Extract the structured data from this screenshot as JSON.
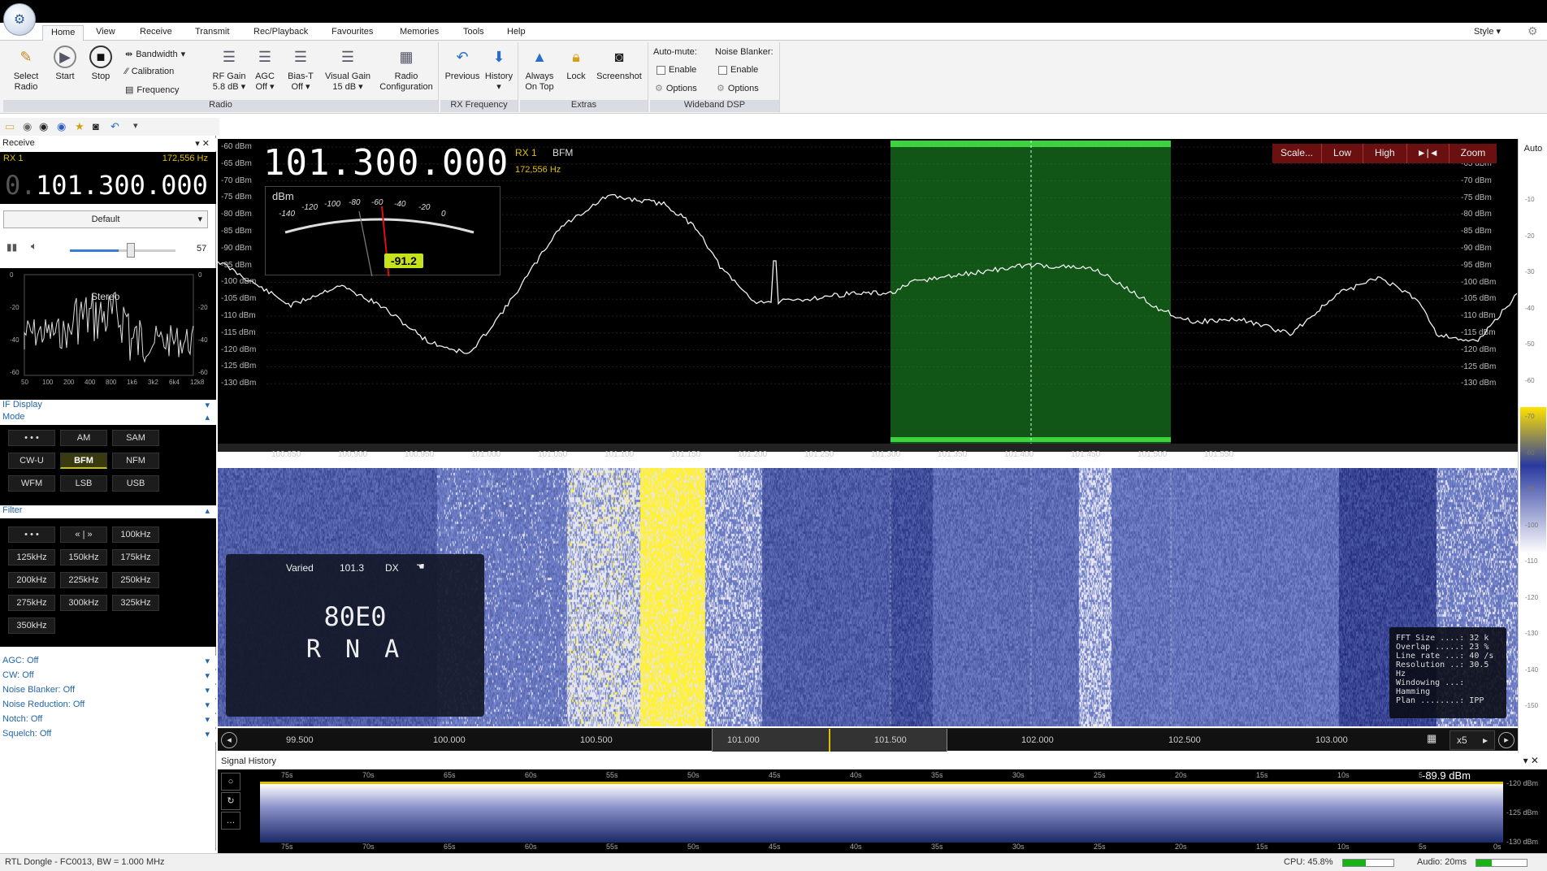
{
  "tabs": [
    "Home",
    "View",
    "Receive",
    "Transmit",
    "Rec/Playback",
    "Favourites",
    "Memories",
    "Tools",
    "Help"
  ],
  "style_label": "Style",
  "ribbon": {
    "radio": {
      "group": "Radio",
      "select_radio": "Select Radio",
      "start": "Start",
      "stop": "Stop",
      "bandwidth": "Bandwidth",
      "calibration": "Calibration",
      "frequency": "Frequency",
      "rf_gain": "RF Gain",
      "rf_gain_val": "5.8 dB",
      "agc": "AGC",
      "agc_val": "Off",
      "bias_t": "Bias-T",
      "bias_t_val": "Off",
      "visual_gain": "Visual Gain",
      "visual_gain_val": "15 dB",
      "radio_config": "Radio Configuration"
    },
    "rx_frequency": {
      "group": "RX Frequency",
      "previous": "Previous",
      "history": "History"
    },
    "extras": {
      "group": "Extras",
      "always_on_top": "Always On Top",
      "lock": "Lock",
      "screenshot": "Screenshot"
    },
    "wideband_dsp": {
      "group": "Wideband DSP",
      "auto_mute": "Auto-mute:",
      "noise_blanker": "Noise Blanker:",
      "enable": "Enable",
      "options": "Options"
    }
  },
  "receive_panel": {
    "header": "Receive",
    "rx": "RX 1",
    "rx_freq": "172,556 Hz",
    "freq_prefix": "0.",
    "frequency": "101.300.000",
    "profile": "Default",
    "volume": "57",
    "scope_label": "Stereo",
    "scope_x": [
      "50",
      "100",
      "200",
      "400",
      "800",
      "1k6",
      "3k2",
      "6k4",
      "12k8"
    ],
    "scope_y": [
      "0",
      "-20",
      "-40",
      "-60"
    ],
    "if_display": "IF Display",
    "mode": "Mode",
    "modes": [
      "• • •",
      "AM",
      "SAM",
      "CW-U",
      "BFM",
      "NFM",
      "WFM",
      "LSB",
      "USB"
    ],
    "filter": "Filter",
    "filters": [
      "• • •",
      "« | »",
      "100kHz",
      "125kHz",
      "150kHz",
      "175kHz",
      "200kHz",
      "225kHz",
      "250kHz",
      "275kHz",
      "300kHz",
      "325kHz",
      "350kHz"
    ],
    "options": [
      "AGC: Off",
      "CW: Off",
      "Noise Blanker: Off",
      "Noise Reduction: Off",
      "Notch: Off",
      "Squelch: Off"
    ]
  },
  "spectrum": {
    "frequency": "101.300.000",
    "rx": "RX 1",
    "mode": "BFM",
    "offset": "172,556 Hz",
    "meter_unit": "dBm",
    "meter_ticks": [
      "-140",
      "-120",
      "-100",
      "-80",
      "-60",
      "-40",
      "-20",
      "0"
    ],
    "meter_value": "-91.2",
    "buttons": [
      "Scale...",
      "Low",
      "High",
      "►|◄",
      "Zoom"
    ],
    "auto": "Auto",
    "y_labels": [
      "-60 dBm",
      "-65 dBm",
      "-70 dBm",
      "-75 dBm",
      "-80 dBm",
      "-85 dBm",
      "-90 dBm",
      "-95 dBm",
      "-100 dBm",
      "-105 dBm",
      "-110 dBm",
      "-115 dBm",
      "-120 dBm",
      "-125 dBm",
      "-130 dBm"
    ],
    "right_y_labels": [
      "-65 dBm",
      "-70 dBm",
      "-75 dBm",
      "-80 dBm",
      "-85 dBm",
      "-90 dBm",
      "-95 dBm",
      "-100 dBm",
      "-105 dBm",
      "-110 dBm",
      "-115 dBm",
      "-120 dBm",
      "-125 dBm",
      "-130 dBm"
    ],
    "x_labels": [
      "100.850",
      "100.900",
      "100.950",
      "101.000",
      "101.050",
      "101.100",
      "101.150",
      "101.200",
      "101.250",
      "101.300",
      "101.350",
      "101.400",
      "101.450",
      "101.500",
      "101.550"
    ]
  },
  "rds": {
    "pty": "Varied",
    "freq": "101.3",
    "dx": "DX",
    "ps": "80E0",
    "rt": "R N A"
  },
  "fft_info": {
    "rows": [
      "FFT Size ....: 32 k",
      "Overlap .....: 23 %",
      "Line rate ...: 40 /s",
      "Resolution ..: 30.5 Hz",
      "Windowing ...: Hamming",
      "Plan ........: IPP"
    ]
  },
  "overview": {
    "labels": [
      "99.500",
      "100.000",
      "100.500",
      "101.000",
      "101.500",
      "102.000",
      "102.500",
      "103.000"
    ],
    "zoom": "x5"
  },
  "right_scale": [
    "-10",
    "-20",
    "-30",
    "-40",
    "-50",
    "-60",
    "-70",
    "-80",
    "-90",
    "-100",
    "-110",
    "-120",
    "-130",
    "-140",
    "-150"
  ],
  "signal_history": {
    "title": "Signal History",
    "value": "-89.9 dBm",
    "time_labels": [
      "75s",
      "70s",
      "65s",
      "60s",
      "55s",
      "50s",
      "45s",
      "40s",
      "35s",
      "30s",
      "25s",
      "20s",
      "15s",
      "10s",
      "5s"
    ],
    "bottom_last": "0s",
    "y_labels": [
      "-120 dBm",
      "-125 dBm",
      "-130 dBm"
    ]
  },
  "status": {
    "device": "RTL Dongle - FC0013, BW = 1.000 MHz",
    "cpu": "CPU: 45.8%",
    "cpu_level": 0.45,
    "audio": "Audio: 20ms",
    "audio_level": 0.3
  },
  "colors": {
    "accent": "#2266aa",
    "passband": "#1f9a2a",
    "meter": "#c6e21c",
    "waterfall_hot": "#ffff40"
  }
}
